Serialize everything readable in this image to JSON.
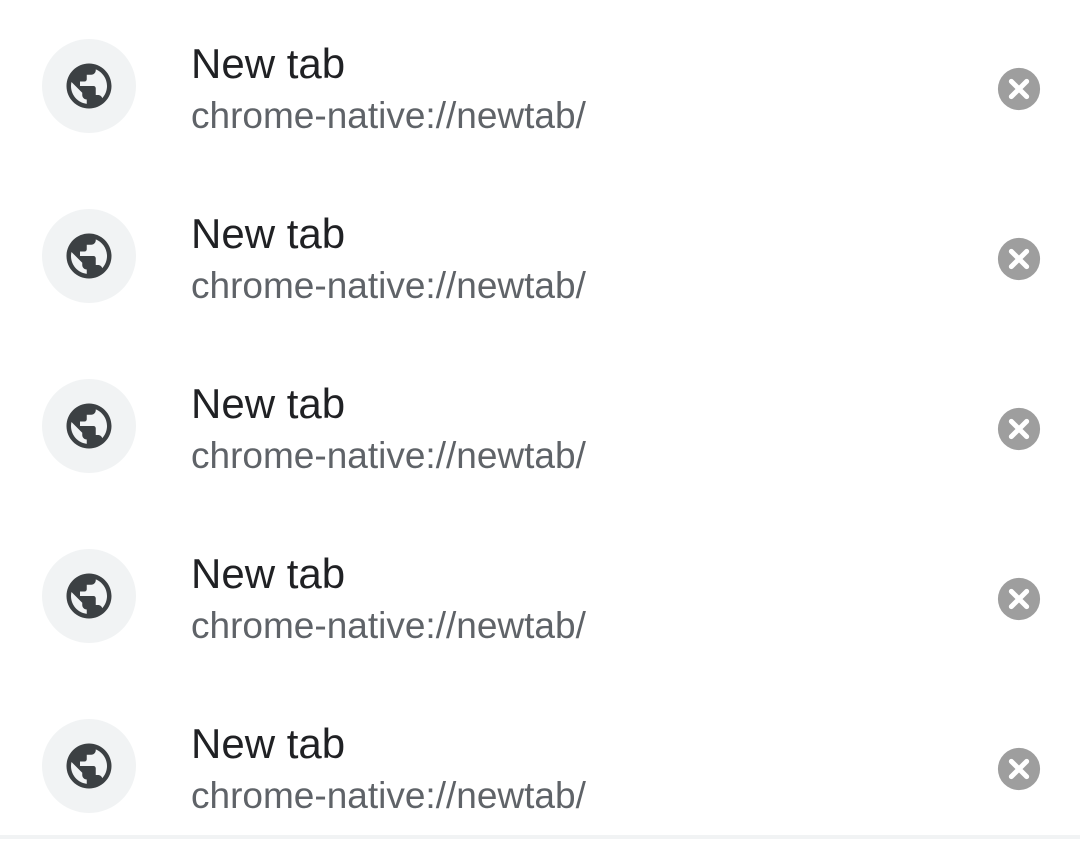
{
  "tabs": [
    {
      "title": "New tab",
      "url": "chrome-native://newtab/",
      "favicon": "globe-icon",
      "close_icon": "close-icon"
    },
    {
      "title": "New tab",
      "url": "chrome-native://newtab/",
      "favicon": "globe-icon",
      "close_icon": "close-icon"
    },
    {
      "title": "New tab",
      "url": "chrome-native://newtab/",
      "favicon": "globe-icon",
      "close_icon": "close-icon"
    },
    {
      "title": "New tab",
      "url": "chrome-native://newtab/",
      "favicon": "globe-icon",
      "close_icon": "close-icon"
    },
    {
      "title": "New tab",
      "url": "chrome-native://newtab/",
      "favicon": "globe-icon",
      "close_icon": "close-icon"
    }
  ],
  "colors": {
    "title_text": "#202124",
    "url_text": "#5f6368",
    "favicon_bg": "#f1f3f4",
    "favicon_glyph": "#3c4043",
    "close_icon": "#9e9e9e"
  }
}
